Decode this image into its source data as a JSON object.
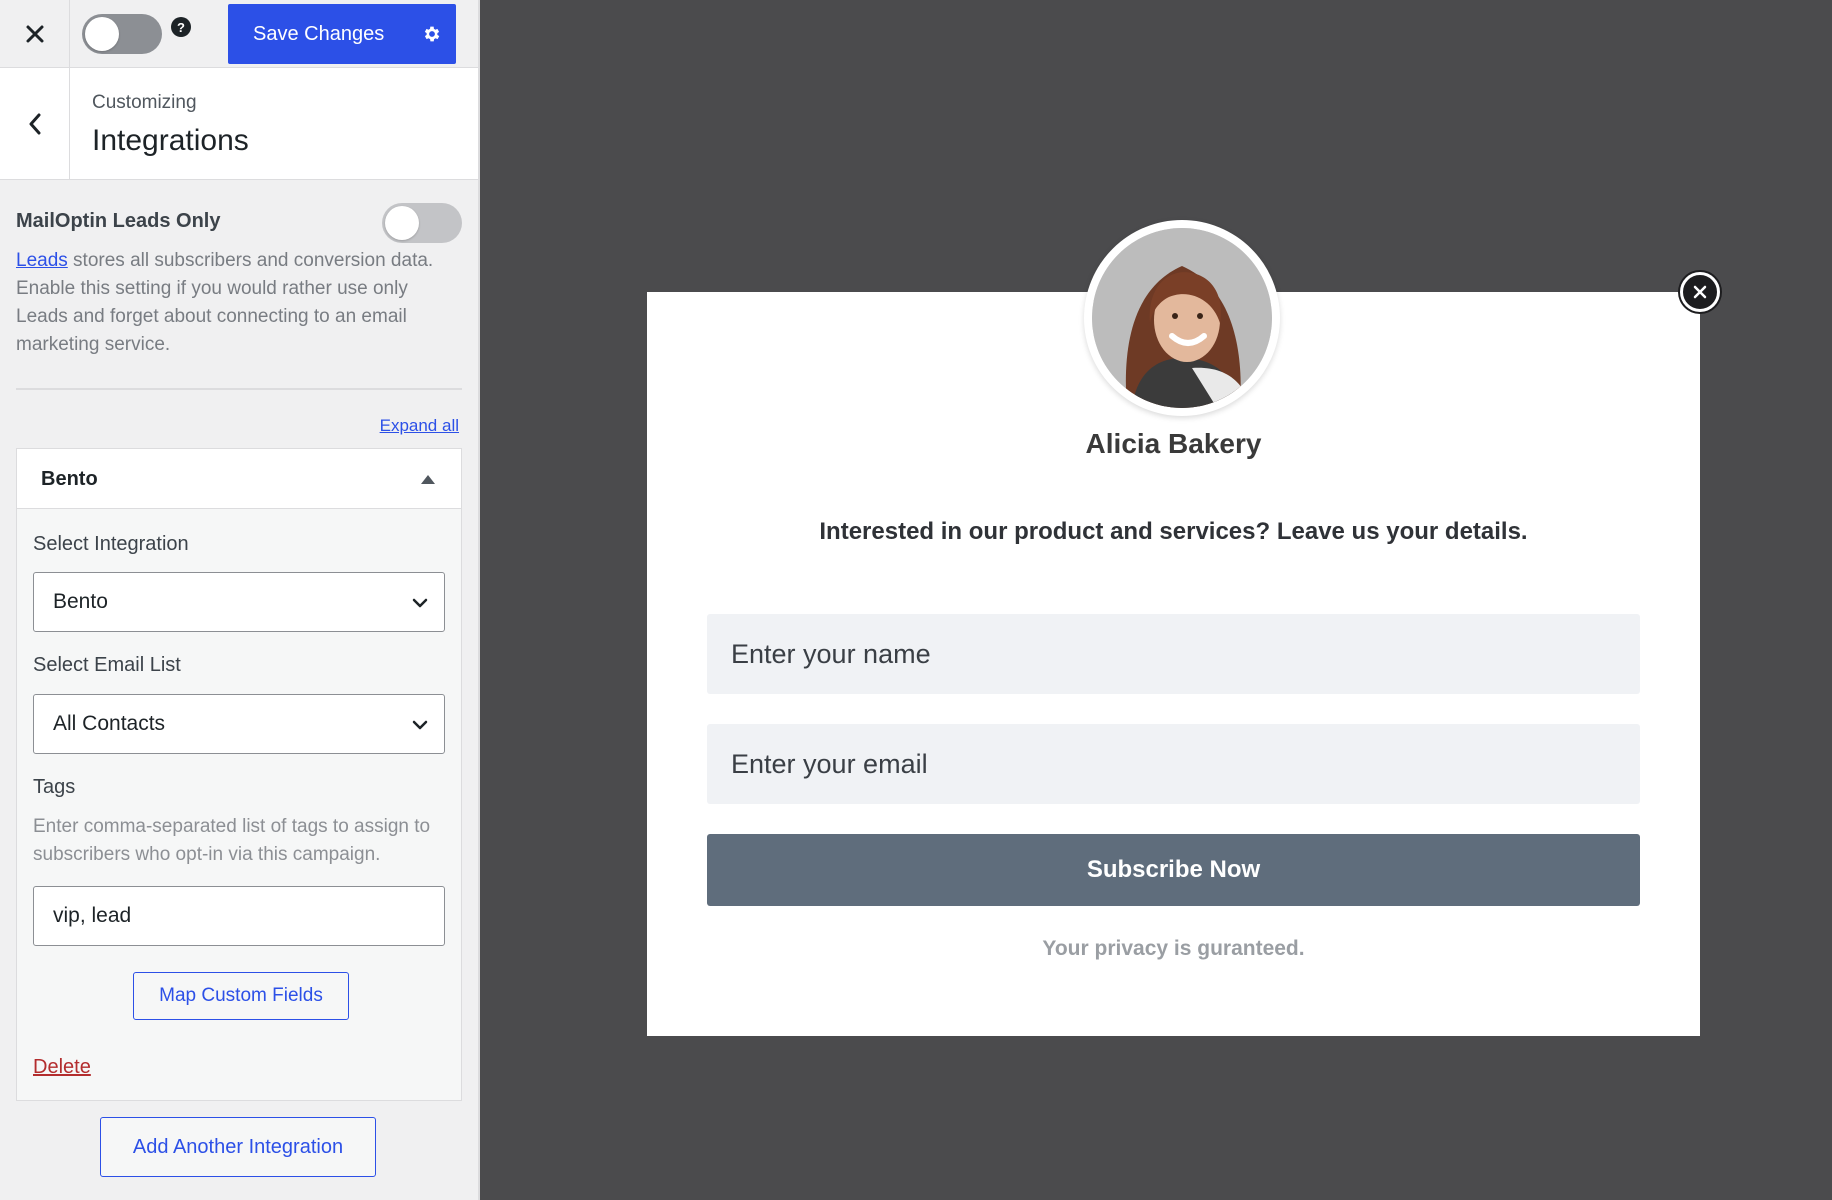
{
  "header": {
    "save_label": "Save Changes",
    "help_symbol": "?"
  },
  "section": {
    "context": "Customizing",
    "title": "Integrations"
  },
  "leads": {
    "label": "MailOptin Leads Only",
    "link_text": "Leads",
    "description": " stores all subscribers and conversion data. Enable this setting if you would rather use only Leads and forget about connecting to an email marketing service.",
    "enabled": false
  },
  "expand_all": "Expand all",
  "integration": {
    "title": "Bento",
    "select_integration_label": "Select Integration",
    "select_integration_value": "Bento",
    "select_list_label": "Select Email List",
    "select_list_value": "All Contacts",
    "tags_label": "Tags",
    "tags_help": "Enter comma-separated list of tags to assign to subscribers who opt-in via this campaign.",
    "tags_value": "vip, lead",
    "map_fields_label": "Map Custom Fields",
    "delete_label": "Delete"
  },
  "add_integration_label": "Add Another Integration",
  "optin": {
    "name": "Alicia Bakery",
    "description": "Interested in our product and services? Leave us your details.",
    "name_placeholder": "Enter your name",
    "email_placeholder": "Enter your email",
    "submit_label": "Subscribe Now",
    "note": "Your privacy is guranteed."
  },
  "colors": {
    "accent": "#2c50e7",
    "delete": "#b32d2e",
    "preview_bg": "#4b4b4d",
    "submit_bg": "#5f6d7c"
  },
  "icons": [
    "close-icon",
    "help-icon",
    "gear-icon",
    "back-chevron-icon",
    "caret-up-icon",
    "chevron-down-icon",
    "popup-close-icon"
  ]
}
